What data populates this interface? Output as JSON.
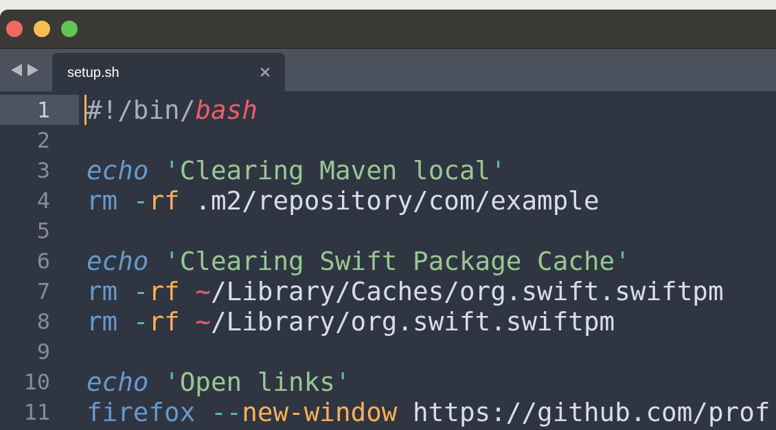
{
  "tabs": [
    {
      "label": "setup.sh",
      "selected": true
    }
  ],
  "editor": {
    "lines": [
      {
        "number": "1",
        "current": true,
        "tokens": [
          {
            "kind": "shebang",
            "text": "#!/bin/"
          },
          {
            "kind": "interpreter",
            "text": "bash"
          }
        ]
      },
      {
        "number": "2",
        "current": false
      },
      {
        "number": "3",
        "current": false,
        "tokens": [
          {
            "kind": "builtin",
            "text": "echo"
          },
          {
            "kind": "quote",
            "text": " '"
          },
          {
            "kind": "string",
            "text": "Clearing Maven local"
          },
          {
            "kind": "quote",
            "text": "'"
          }
        ]
      },
      {
        "number": "4",
        "current": false,
        "tokens": [
          {
            "kind": "command",
            "text": "rm"
          },
          {
            "kind": "operator",
            "text": " -"
          },
          {
            "kind": "flag",
            "text": "rf"
          },
          {
            "kind": "path",
            "text": " .m2/repository/com/example"
          }
        ]
      },
      {
        "number": "5",
        "current": false
      },
      {
        "number": "6",
        "current": false,
        "tokens": [
          {
            "kind": "builtin",
            "text": "echo"
          },
          {
            "kind": "quote",
            "text": " '"
          },
          {
            "kind": "string",
            "text": "Clearing Swift Package Cache"
          },
          {
            "kind": "quote",
            "text": "'"
          }
        ]
      },
      {
        "number": "7",
        "current": false,
        "tokens": [
          {
            "kind": "command",
            "text": "rm"
          },
          {
            "kind": "operator",
            "text": " -"
          },
          {
            "kind": "flag",
            "text": "rf"
          },
          {
            "kind": "tilde",
            "text": " ~"
          },
          {
            "kind": "path",
            "text": "/Library/Caches/org.swift.swiftpm"
          }
        ]
      },
      {
        "number": "8",
        "current": false,
        "tokens": [
          {
            "kind": "command",
            "text": "rm"
          },
          {
            "kind": "operator",
            "text": " -"
          },
          {
            "kind": "flag",
            "text": "rf"
          },
          {
            "kind": "tilde",
            "text": " ~"
          },
          {
            "kind": "path",
            "text": "/Library/org.swift.swiftpm"
          }
        ]
      },
      {
        "number": "9",
        "current": false
      },
      {
        "number": "10",
        "current": false,
        "tokens": [
          {
            "kind": "builtin",
            "text": "echo"
          },
          {
            "kind": "quote",
            "text": " '"
          },
          {
            "kind": "string",
            "text": "Open links"
          },
          {
            "kind": "quote",
            "text": "'"
          }
        ]
      },
      {
        "number": "11",
        "current": false,
        "tokens": [
          {
            "kind": "command",
            "text": "firefox"
          },
          {
            "kind": "operator",
            "text": " --"
          },
          {
            "kind": "flag",
            "text": "new-window"
          },
          {
            "kind": "path",
            "text": " https://github.com/prof"
          }
        ]
      }
    ]
  }
}
